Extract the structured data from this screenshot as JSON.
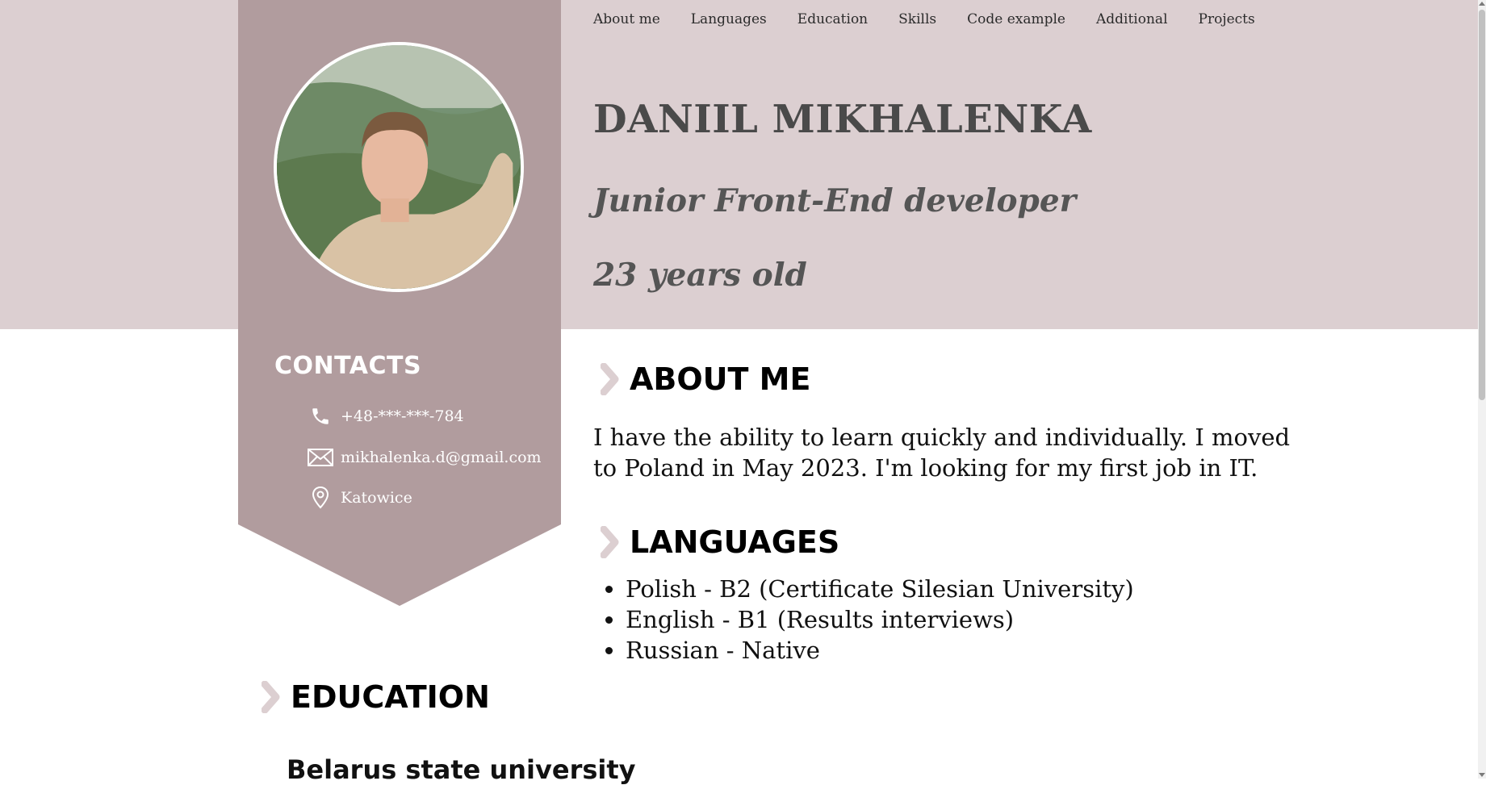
{
  "nav": {
    "items": [
      "About me",
      "Languages",
      "Education",
      "Skills",
      "Code example",
      "Additional",
      "Projects"
    ]
  },
  "header": {
    "name": "DANIIL MIKHALENKA",
    "role": "Junior Front-End developer",
    "age": "23 years old"
  },
  "sidebar": {
    "contacts_title": "CONTACTS",
    "phone": "+48-***-***-784",
    "email": "mikhalenka.d@gmail.com",
    "location": "Katowice",
    "icons": [
      "phone-icon",
      "mail-icon",
      "location-pin-icon"
    ]
  },
  "about": {
    "title": "ABOUT ME",
    "text": "I have the ability to learn quickly and individually. I moved to Poland in May 2023. I'm looking for my first job in IT."
  },
  "languages": {
    "title": "LANGUAGES",
    "items": [
      "Polish - B2 (Certificate Silesian University)",
      "English - B1 (Results interviews)",
      "Russian - Native"
    ]
  },
  "education": {
    "title": "EDUCATION",
    "first_item": "Belarus state university"
  },
  "colors": {
    "header_band": "#dccfd1",
    "sidebar": "#b19c9e",
    "chevron": "#dccfd1",
    "text_dark": "#4a4a4a"
  }
}
